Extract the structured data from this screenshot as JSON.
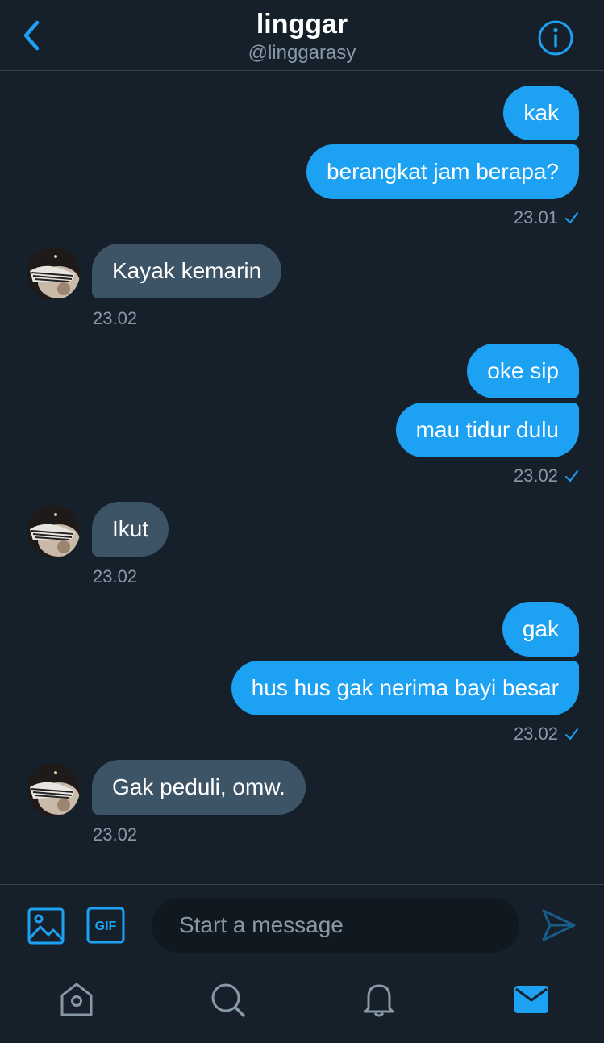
{
  "header": {
    "title": "linggar",
    "handle": "@linggarasy"
  },
  "messages": [
    {
      "side": "out",
      "text": "kak"
    },
    {
      "side": "out",
      "text": "berangkat jam berapa?",
      "time": "23.01"
    },
    {
      "side": "in",
      "text": "Kayak kemarin",
      "time": "23.02"
    },
    {
      "side": "out",
      "text": "oke sip"
    },
    {
      "side": "out",
      "text": "mau tidur dulu",
      "time": "23.02"
    },
    {
      "side": "in",
      "text": "Ikut",
      "time": "23.02"
    },
    {
      "side": "out",
      "text": "gak"
    },
    {
      "side": "out",
      "text": "hus hus gak nerima bayi besar",
      "time": "23.02"
    },
    {
      "side": "in",
      "text": "Gak peduli, omw.",
      "time": "23.02"
    }
  ],
  "composer": {
    "placeholder": "Start a message",
    "gif_label": "GIF"
  },
  "tabs": [
    {
      "icon": "home-icon"
    },
    {
      "icon": "search-icon"
    },
    {
      "icon": "notifications-icon"
    },
    {
      "icon": "messages-icon",
      "active": true
    }
  ],
  "colors": {
    "background": "#15202b",
    "accent": "#1da1f2",
    "incoming_bubble": "#3d5466",
    "secondary_text": "#8899a6"
  }
}
